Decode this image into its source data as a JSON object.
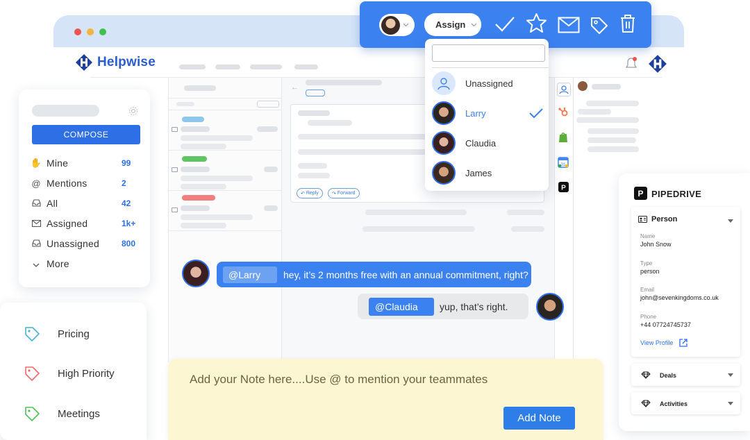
{
  "brand": {
    "name": "Helpwise",
    "color": "#2b5dd1"
  },
  "nav": {
    "compose_label": "COMPOSE",
    "items": [
      {
        "label": "Mine",
        "count": "99",
        "icon": "hand-icon"
      },
      {
        "label": "Mentions",
        "count": "2",
        "icon": "at-icon"
      },
      {
        "label": "All",
        "count": "42",
        "icon": "inbox-icon"
      },
      {
        "label": "Assigned",
        "count": "1k+",
        "icon": "mail-icon"
      },
      {
        "label": "Unassigned",
        "count": "800",
        "icon": "inbox-icon"
      },
      {
        "label": "More",
        "count": "",
        "icon": "chevron-down-icon"
      }
    ]
  },
  "tags": [
    {
      "label": "Pricing",
      "color": "#49b4d9"
    },
    {
      "label": "High Priority",
      "color": "#ef6b6b"
    },
    {
      "label": "Meetings",
      "color": "#52c05a"
    }
  ],
  "toolbar": {
    "assign_label": "Assign",
    "actions": [
      "check-icon",
      "star-icon",
      "mail-icon",
      "tag-icon",
      "trash-icon"
    ]
  },
  "assign_dropdown": {
    "search_placeholder": "",
    "options": [
      {
        "label": "Unassigned",
        "selected": false
      },
      {
        "label": "Larry",
        "selected": true
      },
      {
        "label": "Claudia",
        "selected": false
      },
      {
        "label": "James",
        "selected": false
      }
    ]
  },
  "email": {
    "reply_label": "Reply",
    "forward_label": "Forward"
  },
  "chat": {
    "message1": {
      "mention": "@Larry",
      "text": "hey, it’s 2 months free with an annual commitment, right?"
    },
    "message2": {
      "mention": "@Claudia",
      "text": "yup, that’s right."
    }
  },
  "note": {
    "placeholder": "Add your Note here....Use @ to mention your teammates",
    "button_label": "Add Note"
  },
  "pipedrive": {
    "title": "PIPEDRIVE",
    "person_section": "Person",
    "fields": [
      {
        "key": "Name",
        "value": "John Snow"
      },
      {
        "key": "Type",
        "value": "person"
      },
      {
        "key": "Email",
        "value": "john@sevenkingdoms.co.uk"
      },
      {
        "key": "Phone",
        "value": "+44 07724745737"
      }
    ],
    "view_profile_label": "View Profile",
    "deals_label": "Deals",
    "activities_label": "Activities"
  },
  "colors": {
    "accent": "#3b82f0",
    "note_bg": "#fdf6d3"
  }
}
